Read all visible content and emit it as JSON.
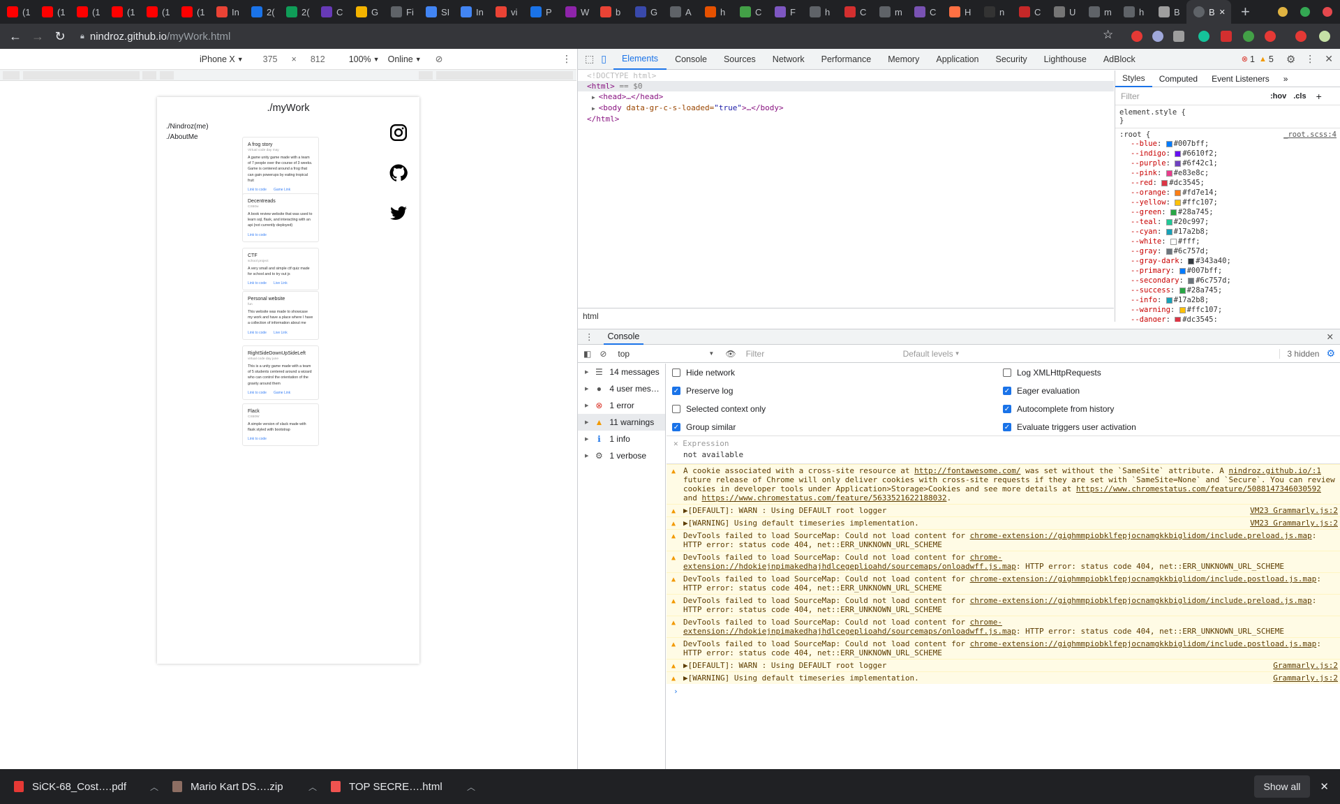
{
  "tabs": [
    {
      "label": "(1",
      "color": "#ff0000"
    },
    {
      "label": "(1",
      "color": "#ff0000"
    },
    {
      "label": "(1",
      "color": "#ff0000"
    },
    {
      "label": "(1",
      "color": "#ff0000"
    },
    {
      "label": "(1",
      "color": "#ff0000"
    },
    {
      "label": "(1",
      "color": "#ff0000"
    },
    {
      "label": "In",
      "color": "#ea4335"
    },
    {
      "label": "2(",
      "color": "#1a73e8"
    },
    {
      "label": "2(",
      "color": "#0f9d58"
    },
    {
      "label": "C",
      "color": "#673ab7"
    },
    {
      "label": "G",
      "color": "#f4b400"
    },
    {
      "label": "Fi",
      "color": "#5f6368"
    },
    {
      "label": "SI",
      "color": "#4285f4"
    },
    {
      "label": "In",
      "color": "#4285f4"
    },
    {
      "label": "vi",
      "color": "#ea4335"
    },
    {
      "label": "P",
      "color": "#1a73e8"
    },
    {
      "label": "W",
      "color": "#8e24aa"
    },
    {
      "label": "b",
      "color": "#ea4335"
    },
    {
      "label": "G",
      "color": "#3949ab"
    },
    {
      "label": "A",
      "color": "#5f6368"
    },
    {
      "label": "h",
      "color": "#e65100"
    },
    {
      "label": "C",
      "color": "#43a047"
    },
    {
      "label": "F",
      "color": "#7e57c2"
    },
    {
      "label": "h",
      "color": "#5f6368"
    },
    {
      "label": "C",
      "color": "#d32f2f"
    },
    {
      "label": "m",
      "color": "#5f6368"
    },
    {
      "label": "C",
      "color": "#7952b3"
    },
    {
      "label": "H",
      "color": "#ff7043"
    },
    {
      "label": "n",
      "color": "#333333"
    },
    {
      "label": "C",
      "color": "#c62828"
    },
    {
      "label": "U",
      "color": "#757575"
    },
    {
      "label": "m",
      "color": "#5f6368"
    },
    {
      "label": "h",
      "color": "#5f6368"
    },
    {
      "label": "B",
      "color": "#9e9e9e"
    }
  ],
  "active_tab": {
    "label": "B"
  },
  "address": {
    "host": "nindroz.github.io",
    "path": "/myWork.html"
  },
  "device_toolbar": {
    "device": "iPhone X",
    "width": "375",
    "x": "×",
    "height": "812",
    "zoom": "100%",
    "throttle": "Online"
  },
  "phone": {
    "title": "./myWork",
    "nav": [
      "./Nindroz(me)",
      "./AboutMe"
    ],
    "cards": [
      {
        "title": "A frog story",
        "sub": "Virtual code day may",
        "desc": "A game unity game made with a team of 7 people over the course of 3 weeks. Game is centered around a frog that can gain powerups by eating tropical fruit",
        "links": [
          "Link to code",
          "Game Link"
        ]
      },
      {
        "title": "Decentreads",
        "sub": "CS50w",
        "desc": "A book review website that was used to learn sql, flask, and interacting with an api (not currently deployed)",
        "links": [
          "Link to code"
        ]
      },
      {
        "title": "CTF",
        "sub": "school project",
        "desc": "A very small and simple ctf quiz made for school and to try out js",
        "links": [
          "Link to code",
          "Live Link"
        ]
      },
      {
        "title": "Personal website",
        "sub": "fun",
        "desc": "This website was made to showcase my work and have a place where I have a collection of information about me",
        "links": [
          "Link to code",
          "Live Link"
        ]
      },
      {
        "title": "RightSideDownUpSideLeft",
        "sub": "virtual code day june",
        "desc": "This is a unity game made with a team of 5 students centered around a wizard who can control the orientation of the gravity around them",
        "links": [
          "Link to code",
          "Game Link"
        ]
      },
      {
        "title": "Flack",
        "sub": "CS50W",
        "desc": "A simple version of slack made with flask styled with bootstrap",
        "links": [
          "Link to code"
        ]
      }
    ]
  },
  "devtools": {
    "tabs": [
      "Elements",
      "Console",
      "Sources",
      "Network",
      "Performance",
      "Memory",
      "Application",
      "Security",
      "Lighthouse",
      "AdBlock"
    ],
    "errors": "1",
    "warnings": "5",
    "dom": {
      "doctype": "<!DOCTYPE html>",
      "html_open": "<html>",
      "eq": " == $0",
      "head": "<head>…</head>",
      "body_tag": "<body",
      "body_attr": " data-gr-c-s-loaded=",
      "body_val": "\"true\"",
      "body_close": ">…</body>",
      "html_close": "</html>"
    },
    "breadcrumb": "html",
    "styles_tabs": [
      "Styles",
      "Computed",
      "Event Listeners"
    ],
    "styles_filter": "Filter",
    "hov": ":hov",
    "cls": ".cls",
    "element_style": "element.style {",
    "root_selector": ":root {",
    "root_source": "_root.scss:4",
    "vars": [
      {
        "name": "--blue",
        "value": "#007bff"
      },
      {
        "name": "--indigo",
        "value": "#6610f2"
      },
      {
        "name": "--purple",
        "value": "#6f42c1"
      },
      {
        "name": "--pink",
        "value": "#e83e8c"
      },
      {
        "name": "--red",
        "value": "#dc3545"
      },
      {
        "name": "--orange",
        "value": "#fd7e14"
      },
      {
        "name": "--yellow",
        "value": "#ffc107"
      },
      {
        "name": "--green",
        "value": "#28a745"
      },
      {
        "name": "--teal",
        "value": "#20c997"
      },
      {
        "name": "--cyan",
        "value": "#17a2b8"
      },
      {
        "name": "--white",
        "value": "#fff"
      },
      {
        "name": "--gray",
        "value": "#6c757d"
      },
      {
        "name": "--gray-dark",
        "value": "#343a40"
      },
      {
        "name": "--primary",
        "value": "#007bff"
      },
      {
        "name": "--secondary",
        "value": "#6c757d"
      },
      {
        "name": "--success",
        "value": "#28a745"
      },
      {
        "name": "--info",
        "value": "#17a2b8"
      },
      {
        "name": "--warning",
        "value": "#ffc107"
      },
      {
        "name": "--danger",
        "value": "#dc3545"
      }
    ],
    "console": {
      "title": "Console",
      "context": "top",
      "filter": "Filter",
      "levels": "Default levels",
      "hidden": "3 hidden",
      "sidebar": [
        {
          "label": "14 messages",
          "icon": "list"
        },
        {
          "label": "4 user mes…",
          "icon": "user"
        },
        {
          "label": "1 error",
          "icon": "error"
        },
        {
          "label": "11 warnings",
          "icon": "warning"
        },
        {
          "label": "1 info",
          "icon": "info"
        },
        {
          "label": "1 verbose",
          "icon": "verbose"
        }
      ],
      "options_left": [
        {
          "label": "Hide network",
          "on": false
        },
        {
          "label": "Preserve log",
          "on": true
        },
        {
          "label": "Selected context only",
          "on": false
        },
        {
          "label": "Group similar",
          "on": true
        }
      ],
      "options_right": [
        {
          "label": "Log XMLHttpRequests",
          "on": false
        },
        {
          "label": "Eager evaluation",
          "on": true
        },
        {
          "label": "Autocomplete from history",
          "on": true
        },
        {
          "label": "Evaluate triggers user activation",
          "on": true
        }
      ],
      "expression_label": "Expression",
      "expression_value": "not available",
      "cookie_msg": {
        "a": "A cookie associated with a cross-site resource at ",
        "link1": "http://fontawesome.com/",
        "b": " was set without the `SameSite` attribute. A ",
        "src": "nindroz.github.io/:1",
        "c": "future release of Chrome will only deliver cookies with cross-site requests if they are set with `SameSite=None` and `Secure`. You can review cookies in developer tools under Application>Storage>Cookies and see more details at ",
        "link2": "https://www.chromestatus.com/feature/5088147346030592",
        "d": " and ",
        "link3": "https://www.chromestatus.com/feature/5633521622188032",
        "e": "."
      },
      "messages": [
        {
          "text": "▶[DEFAULT]: WARN : Using DEFAULT root logger",
          "src": "VM23 Grammarly.js:2"
        },
        {
          "text": "▶[WARNING] Using default timeseries implementation.",
          "src": "VM23 Grammarly.js:2"
        },
        {
          "text": "DevTools failed to load SourceMap: Could not load content for ",
          "link": "chrome-extension://gighmmpiobklfepjocnamgkkbiglidom/include.preload.js.map",
          "tail": ": HTTP error: status code 404, net::ERR_UNKNOWN_URL_SCHEME"
        },
        {
          "text": "DevTools failed to load SourceMap: Could not load content for ",
          "link": "chrome-extension://hdokiejnpimakedhajhdlcegeplioahd/sourcemaps/onloadwff.js.map",
          "tail": ": HTTP error: status code 404, net::ERR_UNKNOWN_URL_SCHEME"
        },
        {
          "text": "DevTools failed to load SourceMap: Could not load content for ",
          "link": "chrome-extension://gighmmpiobklfepjocnamgkkbiglidom/include.postload.js.map",
          "tail": ": HTTP error: status code 404, net::ERR_UNKNOWN_URL_SCHEME"
        },
        {
          "text": "DevTools failed to load SourceMap: Could not load content for ",
          "link": "chrome-extension://gighmmpiobklfepjocnamgkkbiglidom/include.preload.js.map",
          "tail": ": HTTP error: status code 404, net::ERR_UNKNOWN_URL_SCHEME"
        },
        {
          "text": "DevTools failed to load SourceMap: Could not load content for ",
          "link": "chrome-extension://hdokiejnpimakedhajhdlcegeplioahd/sourcemaps/onloadwff.js.map",
          "tail": ": HTTP error: status code 404, net::ERR_UNKNOWN_URL_SCHEME"
        },
        {
          "text": "DevTools failed to load SourceMap: Could not load content for ",
          "link": "chrome-extension://gighmmpiobklfepjocnamgkkbiglidom/include.postload.js.map",
          "tail": ": HTTP error: status code 404, net::ERR_UNKNOWN_URL_SCHEME"
        },
        {
          "text": "▶[DEFAULT]: WARN : Using DEFAULT root logger",
          "src": "Grammarly.js:2"
        },
        {
          "text": "▶[WARNING] Using default timeseries implementation.",
          "src": "Grammarly.js:2"
        }
      ]
    }
  },
  "downloads": [
    {
      "name": "SiCK-68_Cost….pdf",
      "color": "#e53935"
    },
    {
      "name": "Mario Kart DS….zip",
      "color": "#8d6e63"
    },
    {
      "name": "TOP SECRE….html",
      "color": "#ef5350"
    }
  ],
  "show_all": "Show all"
}
